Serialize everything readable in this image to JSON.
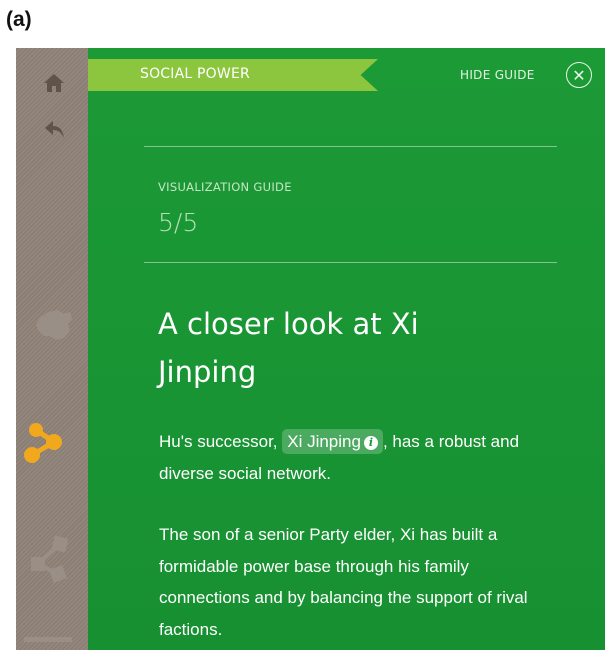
{
  "figure_label": "(a)",
  "sidebar": {
    "items": [
      {
        "icon": "home-icon"
      },
      {
        "icon": "back-arrow-icon"
      },
      {
        "icon": "china-map-icon"
      },
      {
        "icon": "network-nodes-icon",
        "active": true
      },
      {
        "icon": "hierarchy-icon"
      },
      {
        "icon": "timeline-icon"
      }
    ]
  },
  "header": {
    "section_title": "SOCIAL POWER",
    "hide_guide_label": "HIDE GUIDE",
    "close_symbol": "✕"
  },
  "guide": {
    "label": "VISUALIZATION GUIDE",
    "step": "5/5"
  },
  "content": {
    "heading": "A closer look at Xi Jinping",
    "p1_before": "Hu's successor, ",
    "p1_chip": "Xi Jinping",
    "p1_info": "i",
    "p1_after": ", has a robust and diverse social network.",
    "p2": "The son of a senior Party elder, Xi has built a formidable power base through his family connections and by balancing the support of rival factions."
  },
  "colors": {
    "panel_green": "#1c9a36",
    "ribbon_green": "#8cc63f",
    "sidebar_gray": "#8b7e74",
    "active_orange": "#f2a81d"
  }
}
